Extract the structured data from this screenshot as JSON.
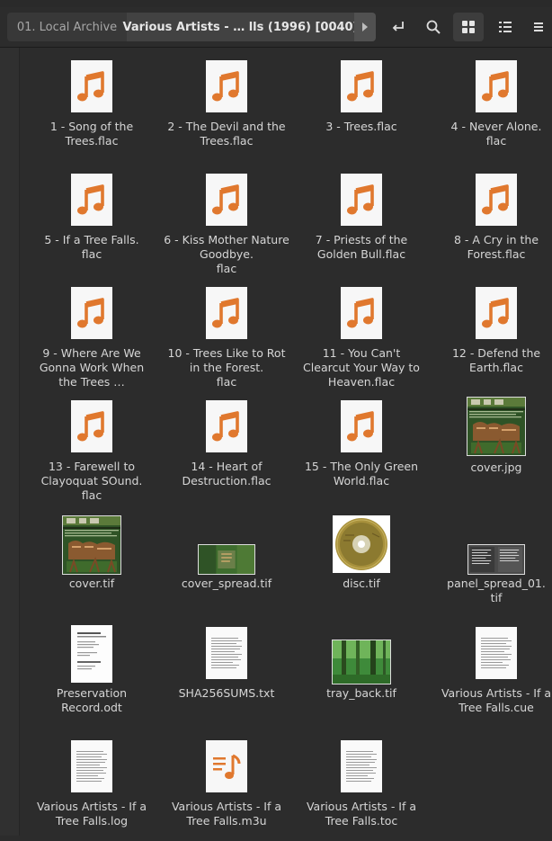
{
  "toolbar": {
    "breadcrumbs": [
      "01. Local Archive",
      "Various Artists - … lls (1996) [0040]"
    ],
    "buttons": [
      "return-icon",
      "search-icon",
      "grid-view-icon",
      "list-view-icon",
      "menu-icon"
    ]
  },
  "files": [
    {
      "name": "1 - Song of the Trees.flac",
      "type": "audio"
    },
    {
      "name": "2 - The Devil and the Trees.flac",
      "type": "audio"
    },
    {
      "name": "3 - Trees.flac",
      "type": "audio"
    },
    {
      "name": "4 - Never Alone.\nflac",
      "type": "audio"
    },
    {
      "name": "5 - If a Tree Falls.\nflac",
      "type": "audio"
    },
    {
      "name": "6 - Kiss Mother Nature Goodbye.\nflac",
      "type": "audio"
    },
    {
      "name": "7 - Priests of the Golden Bull.flac",
      "type": "audio"
    },
    {
      "name": "8 - A Cry in the Forest.flac",
      "type": "audio"
    },
    {
      "name": "9 - Where Are We Gonna Work When the Trees …",
      "type": "audio"
    },
    {
      "name": "10 - Trees Like to Rot in the Forest.\nflac",
      "type": "audio"
    },
    {
      "name": "11 - You Can't Clearcut Your Way to Heaven.flac",
      "type": "audio"
    },
    {
      "name": "12 - Defend the Earth.flac",
      "type": "audio"
    },
    {
      "name": "13 - Farewell to Clayoquat SOund.\nflac",
      "type": "audio"
    },
    {
      "name": "14 - Heart of Destruction.flac",
      "type": "audio"
    },
    {
      "name": "15 - The Only Green World.flac",
      "type": "audio"
    },
    {
      "name": "cover.jpg",
      "type": "cover"
    },
    {
      "name": "cover.tif",
      "type": "cover"
    },
    {
      "name": "cover_spread.tif",
      "type": "spread"
    },
    {
      "name": "disc.tif",
      "type": "disc"
    },
    {
      "name": "panel_spread_01.\ntif",
      "type": "panel"
    },
    {
      "name": "Preservation Record.odt",
      "type": "odt"
    },
    {
      "name": "SHA256SUMS.txt",
      "type": "text"
    },
    {
      "name": "tray_back.tif",
      "type": "forest"
    },
    {
      "name": "Various Artists - If a Tree Falls.cue",
      "type": "text"
    },
    {
      "name": "Various Artists - If a Tree Falls.log",
      "type": "text"
    },
    {
      "name": "Various Artists - If a Tree Falls.m3u",
      "type": "playlist"
    },
    {
      "name": "Various Artists - If a Tree Falls.toc",
      "type": "text"
    }
  ],
  "colors": {
    "background": "#2c2c2c",
    "accent_orange": "#e0782e",
    "text": "#d6d6d6"
  }
}
